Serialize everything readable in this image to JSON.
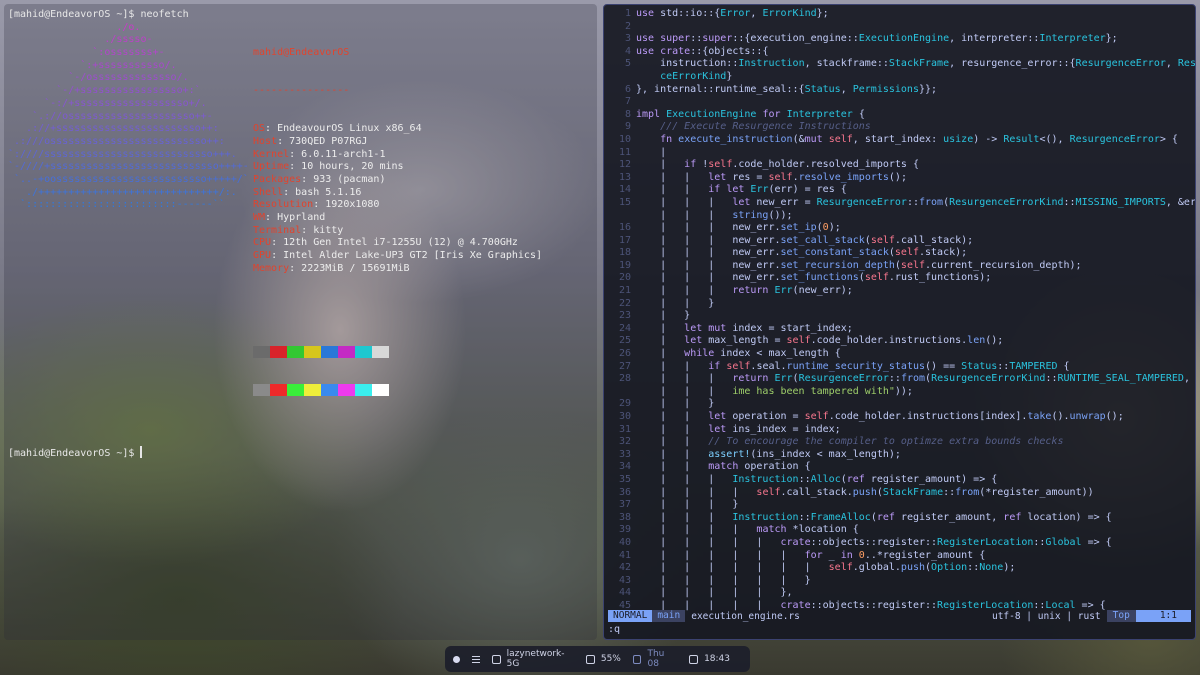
{
  "colors": {
    "neofetch_logo_magenta": "#c43fc8",
    "neofetch_logo_blue": "#3a6cd8",
    "neofetch_key_red": "#e0442e",
    "editor_bg": "#16182a",
    "status_mode_bg": "#7aa2f7"
  },
  "left_terminal": {
    "prompt1": "[mahid@EndeavorOS ~]$ neofetch",
    "prompt2": "[mahid@EndeavorOS ~]$ ",
    "logo_lines": [
      "                  ./o.",
      "                ./sssso-",
      "              `:osssssss+-",
      "            `:+sssssssssso/.",
      "          `-/ossssssssssssso/.",
      "        `-/+sssssssssssssssso+:`",
      "      `-:/+sssssssssssssssssso+/.",
      "    `.://osssssssssssssssssssso++-",
      "   .://+ssssssssssssssssssssssso++:",
      " .:///ossssssssssssssssssssssssso++:",
      "`:////ssssssssssssssssssssssssssso+++.",
      "`-////+ssssssssssssssssssssssssssso++++-",
      " `..-+oosssssssssssssssssssssssso+++++/`",
      "   ./++++++++++++++++++++++++++++++/:.",
      "  `:::::::::::::::::::::::::------``"
    ],
    "user_host": "mahid@EndeavorOS",
    "separator": "----------------",
    "info": [
      {
        "key": "OS",
        "value": "EndeavourOS Linux x86_64"
      },
      {
        "key": "Host",
        "value": "730QED P07RGJ"
      },
      {
        "key": "Kernel",
        "value": "6.0.11-arch1-1"
      },
      {
        "key": "Uptime",
        "value": "10 hours, 20 mins"
      },
      {
        "key": "Packages",
        "value": "933 (pacman)"
      },
      {
        "key": "Shell",
        "value": "bash 5.1.16"
      },
      {
        "key": "Resolution",
        "value": "1920x1080"
      },
      {
        "key": "WM",
        "value": "Hyprland"
      },
      {
        "key": "Terminal",
        "value": "kitty"
      },
      {
        "key": "CPU",
        "value": "12th Gen Intel i7-1255U (12) @ 4.700GHz"
      },
      {
        "key": "GPU",
        "value": "Intel Alder Lake-UP3 GT2 [Iris Xe Graphics]"
      },
      {
        "key": "Memory",
        "value": "2223MiB / 15691MiB"
      }
    ],
    "swatches_top": [
      "#6b6b6b",
      "#d8232a",
      "#32c832",
      "#d6c61c",
      "#2a78d8",
      "#c42ac4",
      "#1ec8d0",
      "#d8d8d8"
    ],
    "swatches_bottom": [
      "#8a8a8a",
      "#ee2a2a",
      "#3aee3a",
      "#eeee3a",
      "#3a8aee",
      "#ee3aee",
      "#3aeeee",
      "#ffffff"
    ]
  },
  "editor": {
    "lines": [
      {
        "n": "1",
        "html": "<span class='kw'>use</span> std::io::{<span class='ty'>Error</span>, <span class='ty'>ErrorKind</span>};"
      },
      {
        "n": "2",
        "html": ""
      },
      {
        "n": "3",
        "html": "<span class='kw'>use</span> <span class='kw'>super</span>::<span class='kw'>super</span>::{execution_engine::<span class='ty'>ExecutionEngine</span>, interpreter::<span class='ty'>Interpreter</span>};"
      },
      {
        "n": "4",
        "html": "<span class='kw'>use</span> <span class='kw'>crate</span>::{objects::{"
      },
      {
        "n": "5",
        "html": "    instruction::<span class='ty'>Instruction</span>, stackframe::<span class='ty'>StackFrame</span>, resurgence_error::{<span class='ty'>ResurgenceError</span>, <span class='ty'>Resurgen</span>"
      },
      {
        "n": "",
        "html": "    <span class='ty'>ceErrorKind</span>}"
      },
      {
        "n": "6",
        "html": "}, internal::runtime_seal::{<span class='ty'>Status</span>, <span class='ty'>Permissions</span>}};"
      },
      {
        "n": "7",
        "html": ""
      },
      {
        "n": "8",
        "html": "<span class='kw'>impl</span> <span class='ty'>ExecutionEngine</span> <span class='kw'>for</span> <span class='ty'>Interpreter</span> {"
      },
      {
        "n": "9",
        "html": "    <span class='cm'>/// Execute Resurgence Instructions</span>"
      },
      {
        "n": "10",
        "html": "    <span class='kw'>fn</span> <span class='fn'>execute_instruction</span>(&amp;<span class='kw'>mut</span> <span class='sf'>self</span>, start_index: <span class='ty'>usize</span>) -&gt; <span class='ty'>Result</span>&lt;(), <span class='ty'>ResurgenceError</span>&gt; {"
      },
      {
        "n": "11",
        "html": "    |"
      },
      {
        "n": "12",
        "html": "    |   <span class='kw'>if</span> !<span class='sf'>self</span>.code_holder.resolved_imports {"
      },
      {
        "n": "13",
        "html": "    |   |   <span class='kw'>let</span> res = <span class='sf'>self</span>.<span class='fn'>resolve_imports</span>();"
      },
      {
        "n": "14",
        "html": "    |   |   <span class='kw'>if</span> <span class='kw'>let</span> <span class='ty'>Err</span>(err) = res {"
      },
      {
        "n": "15",
        "html": "    |   |   |   <span class='kw'>let</span> new_err = <span class='ty'>ResurgenceError</span>::<span class='fn'>from</span>(<span class='ty'>ResurgenceErrorKind</span>::<span class='ty'>MISSING_IMPORTS</span>, &amp;err.<span class='fn'>to_</span>"
      },
      {
        "n": "",
        "html": "    |   |   |   <span class='fn'>string</span>());"
      },
      {
        "n": "16",
        "html": "    |   |   |   new_err.<span class='fn'>set_ip</span>(<span class='nu'>0</span>);"
      },
      {
        "n": "17",
        "html": "    |   |   |   new_err.<span class='fn'>set_call_stack</span>(<span class='sf'>self</span>.call_stack);"
      },
      {
        "n": "18",
        "html": "    |   |   |   new_err.<span class='fn'>set_constant_stack</span>(<span class='sf'>self</span>.stack);"
      },
      {
        "n": "19",
        "html": "    |   |   |   new_err.<span class='fn'>set_recursion_depth</span>(<span class='sf'>self</span>.current_recursion_depth);"
      },
      {
        "n": "20",
        "html": "    |   |   |   new_err.<span class='fn'>set_functions</span>(<span class='sf'>self</span>.rust_functions);"
      },
      {
        "n": "21",
        "html": "    |   |   |   <span class='kw'>return</span> <span class='ty'>Err</span>(new_err);"
      },
      {
        "n": "22",
        "html": "    |   |   }"
      },
      {
        "n": "23",
        "html": "    |   }"
      },
      {
        "n": "24",
        "html": "    |   <span class='kw'>let</span> <span class='kw'>mut</span> index = start_index;"
      },
      {
        "n": "25",
        "html": "    |   <span class='kw'>let</span> max_length = <span class='sf'>self</span>.code_holder.instructions.<span class='fn'>len</span>();"
      },
      {
        "n": "26",
        "html": "    |   <span class='kw'>while</span> index &lt; max_length {"
      },
      {
        "n": "27",
        "html": "    |   |   <span class='kw'>if</span> <span class='sf'>self</span>.seal.<span class='fn'>runtime_security_status</span>() == <span class='ty'>Status</span>::<span class='ty'>TAMPERED</span> {"
      },
      {
        "n": "28",
        "html": "    |   |   |   <span class='kw'>return</span> <span class='ty'>Err</span>(<span class='ty'>ResurgenceError</span>::<span class='fn'>from</span>(<span class='ty'>ResurgenceErrorKind</span>::<span class='ty'>RUNTIME_SEAL_TAMPERED</span>, <span class='st'>\"Runt</span>"
      },
      {
        "n": "",
        "html": "    |   |   |   <span class='st'>ime has been tampered with\"</span>));"
      },
      {
        "n": "29",
        "html": "    |   |   }"
      },
      {
        "n": "30",
        "html": "    |   |   <span class='kw'>let</span> operation = <span class='sf'>self</span>.code_holder.instructions[index].<span class='fn'>take</span>().<span class='fn'>unwrap</span>();"
      },
      {
        "n": "31",
        "html": "    |   |   <span class='kw'>let</span> ins_index = index;"
      },
      {
        "n": "32",
        "html": "    |   |   <span class='cm'>// To encourage the compiler to optimze extra bounds checks</span>"
      },
      {
        "n": "33",
        "html": "    |   |   <span class='mc'>assert!</span>(ins_index &lt; max_length);"
      },
      {
        "n": "34",
        "html": "    |   |   <span class='kw'>match</span> operation {"
      },
      {
        "n": "35",
        "html": "    |   |   |   <span class='ty'>Instruction</span>::<span class='ty'>Alloc</span>(<span class='kw'>ref</span> register_amount) =&gt; {"
      },
      {
        "n": "36",
        "html": "    |   |   |   |   <span class='sf'>self</span>.call_stack.<span class='fn'>push</span>(<span class='ty'>StackFrame</span>::<span class='fn'>from</span>(*register_amount))"
      },
      {
        "n": "37",
        "html": "    |   |   |   }"
      },
      {
        "n": "38",
        "html": "    |   |   |   <span class='ty'>Instruction</span>::<span class='ty'>FrameAlloc</span>(<span class='kw'>ref</span> register_amount, <span class='kw'>ref</span> location) =&gt; {"
      },
      {
        "n": "39",
        "html": "    |   |   |   |   <span class='kw'>match</span> *location {"
      },
      {
        "n": "40",
        "html": "    |   |   |   |   |   <span class='kw'>crate</span>::objects::register::<span class='ty'>RegisterLocation</span>::<span class='ty'>Global</span> =&gt; {"
      },
      {
        "n": "41",
        "html": "    |   |   |   |   |   |   <span class='kw'>for</span> _ <span class='kw'>in</span> <span class='nu'>0</span>..*register_amount {"
      },
      {
        "n": "42",
        "html": "    |   |   |   |   |   |   |   <span class='sf'>self</span>.global.<span class='fn'>push</span>(<span class='ty'>Option</span>::<span class='ty'>None</span>);"
      },
      {
        "n": "43",
        "html": "    |   |   |   |   |   |   }"
      },
      {
        "n": "44",
        "html": "    |   |   |   |   |   },"
      },
      {
        "n": "45",
        "html": "    |   |   |   |   |   <span class='kw'>crate</span>::objects::register::<span class='ty'>RegisterLocation</span>::<span class='ty'>Local</span> =&gt; {"
      }
    ],
    "status": {
      "mode": "NORMAL",
      "branch": "main",
      "filename": "execution_engine.rs",
      "encoding": "utf-8 | unix | rust",
      "scroll": "Top",
      "position": "1:1"
    },
    "cmdline": ":q"
  },
  "taskbar": {
    "wifi": "lazynetwork-5G",
    "battery": "55%",
    "date": "Thu 08",
    "time": "18:43"
  }
}
